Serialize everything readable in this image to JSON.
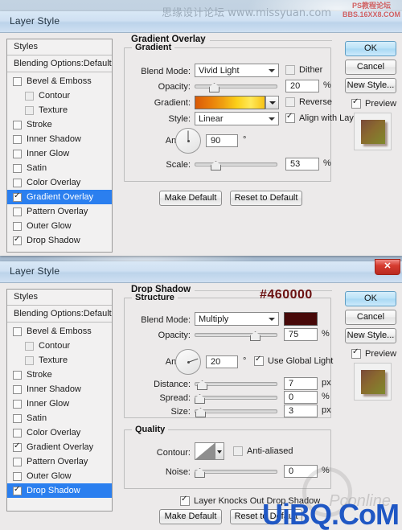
{
  "window": {
    "title": "Layer Style",
    "close_label": "✕"
  },
  "styles_panel": {
    "header": "Styles",
    "blending_options": "Blending Options:Default",
    "effects": [
      {
        "label": "Bevel & Emboss",
        "checked": false,
        "sub": false
      },
      {
        "label": "Contour",
        "checked": false,
        "sub": true
      },
      {
        "label": "Texture",
        "checked": false,
        "sub": true
      },
      {
        "label": "Stroke",
        "checked": false,
        "sub": false
      },
      {
        "label": "Inner Shadow",
        "checked": false,
        "sub": false
      },
      {
        "label": "Inner Glow",
        "checked": false,
        "sub": false
      },
      {
        "label": "Satin",
        "checked": false,
        "sub": false
      },
      {
        "label": "Color Overlay",
        "checked": false,
        "sub": false
      },
      {
        "label": "Gradient Overlay",
        "checked": true,
        "sub": false
      },
      {
        "label": "Pattern Overlay",
        "checked": false,
        "sub": false
      },
      {
        "label": "Outer Glow",
        "checked": false,
        "sub": false
      },
      {
        "label": "Drop Shadow",
        "checked": true,
        "sub": false
      }
    ]
  },
  "buttons": {
    "ok": "OK",
    "cancel": "Cancel",
    "new_style": "New Style...",
    "preview": "Preview",
    "make_default": "Make Default",
    "reset_default": "Reset to Default"
  },
  "dialog1": {
    "section_title": "Gradient Overlay",
    "group_label": "Gradient",
    "blend_mode_label": "Blend Mode:",
    "blend_mode_value": "Vivid Light",
    "dither_label": "Dither",
    "dither_checked": false,
    "opacity_label": "Opacity:",
    "opacity_value": "20",
    "opacity_unit": "%",
    "opacity_percent": 20,
    "gradient_label": "Gradient:",
    "gradient_stops": [
      "#d95a08",
      "#e87a0a",
      "#f0a011",
      "#fbd01a",
      "#ffe95a",
      "#f7c215"
    ],
    "reverse_label": "Reverse",
    "reverse_checked": false,
    "style_label": "Style:",
    "style_value": "Linear",
    "align_label": "Align with Layer",
    "align_checked": true,
    "angle_label": "Angle:",
    "angle_value": "90",
    "angle_unit": "°",
    "angle_degrees": 90,
    "scale_label": "Scale:",
    "scale_value": "53",
    "scale_unit": "%",
    "scale_percent": 22
  },
  "dialog2": {
    "section_title": "Drop Shadow",
    "structure_label": "Structure",
    "hex_label": "#460000",
    "hex_color": "#460000",
    "blend_mode_label": "Blend Mode:",
    "blend_mode_value": "Multiply",
    "shadow_color": "#470909",
    "opacity_label": "Opacity:",
    "opacity_value": "75",
    "opacity_unit": "%",
    "opacity_percent": 75,
    "angle_label": "Angle:",
    "angle_value": "20",
    "angle_unit": "°",
    "angle_degrees": 20,
    "global_light_label": "Use Global Light",
    "global_light_checked": true,
    "distance_label": "Distance:",
    "distance_value": "7",
    "distance_unit": "px",
    "distance_percent": 3,
    "spread_label": "Spread:",
    "spread_value": "0",
    "spread_unit": "%",
    "spread_percent": 0,
    "size_label": "Size:",
    "size_value": "3",
    "size_unit": "px",
    "size_percent": 1,
    "quality_label": "Quality",
    "contour_label": "Contour:",
    "antialiased_label": "Anti-aliased",
    "antialiased_checked": false,
    "noise_label": "Noise:",
    "noise_value": "0",
    "noise_unit": "%",
    "noise_percent": 0,
    "knockout_label": "Layer Knocks Out Drop Shadow",
    "knockout_checked": true
  },
  "watermarks": {
    "top_cn": "思缘设计论坛  www.missyuan.com",
    "top_red_line1": "PS教程论坛",
    "top_red_line2": "BBS.16XX8.COM",
    "bottom": "UiBQ.CoM",
    "pconline": "Pconline"
  }
}
